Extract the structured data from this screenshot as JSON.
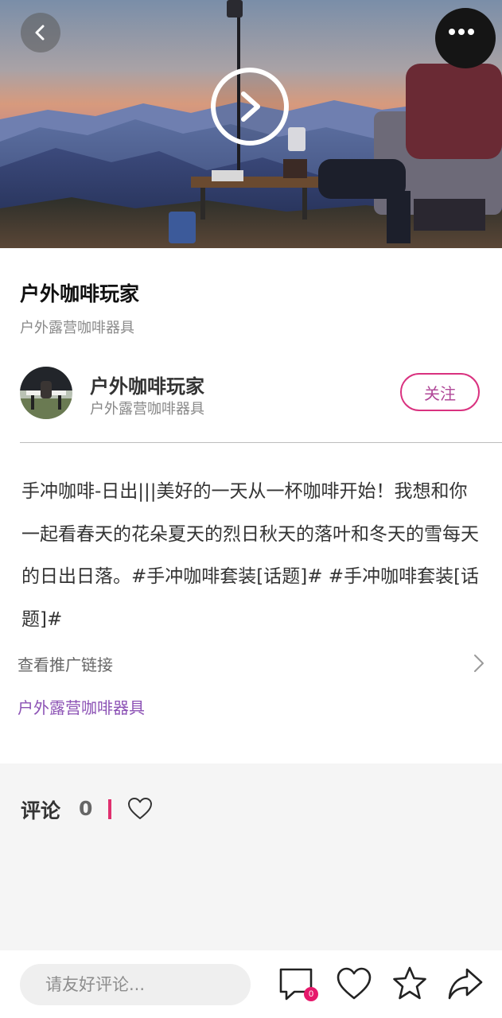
{
  "header": {
    "back_icon": "chevron-left-icon",
    "more_icon": "ellipsis-icon",
    "play_icon": "play-icon"
  },
  "post": {
    "title": "户外咖啡玩家",
    "subtitle": "户外露营咖啡器具",
    "body": "手冲咖啡-日出|||美好的一天从一杯咖啡开始！我想和你一起看春天的花朵夏天的烈日秋天的落叶和冬天的雪每天的日出日落。#手冲咖啡套装[话题]# #手冲咖啡套装[话题]#",
    "promo_link_label": "查看推广链接",
    "tag_link": "户外露营咖啡器具"
  },
  "author": {
    "name": "户外咖啡玩家",
    "description": "户外露营咖啡器具",
    "follow_label": "关注"
  },
  "comments": {
    "heading": "评论",
    "count": "0"
  },
  "bottom_bar": {
    "input_placeholder": "请友好评论...",
    "message_badge": "0",
    "icons": [
      "message-icon",
      "heart-icon",
      "star-icon",
      "share-icon"
    ]
  },
  "colors": {
    "accent_pink": "#d9317f",
    "follow_text": "#b04898",
    "tag_purple": "#8c52b5",
    "badge": "#e6186b",
    "comment_bg": "#f5f5f5"
  }
}
